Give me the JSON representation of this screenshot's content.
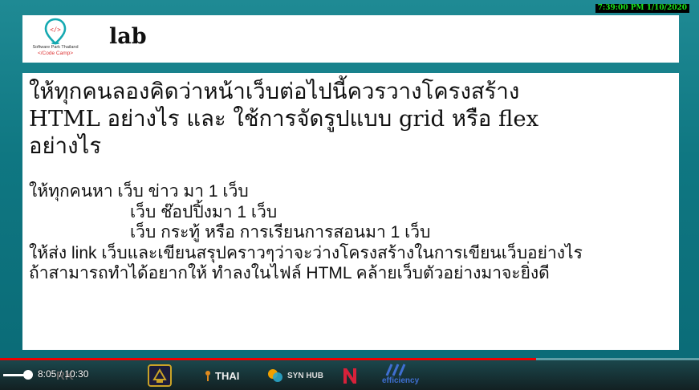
{
  "recording_timestamp": "7:39:00 PM 1/10/2020",
  "header": {
    "logo_line1": "Software Park Thailand",
    "logo_line2": "</Code Camp>",
    "title": "lab"
  },
  "content": {
    "heading_lines": [
      "ให้ทุกคนลองคิดว่าหน้าเว็บต่อไปนี้ควรวางโครงสร้าง",
      "HTML อย่างไร และ ใช้การจัดรูปแบบ grid หรือ flex",
      "อย่างไร"
    ],
    "task_lines": [
      "ให้ทุกคนหา เว็บ ข่าว มา 1 เว็บ",
      "เว็บ ช๊อปปิ้งมา 1 เว็บ",
      "เว็บ กระทู้ หรือ การเรียนการสอนมา 1 เว็บ",
      "ให้ส่ง link เว็บและเขียนสรุปคราวๆว่าจะว่างโครงสร้างในการเขียนเว็บอย่างไร",
      "ถ้าสามารถทำได้อยากให้ ทำลงในไฟล์ HTML คล้ายเว็บตัวอย่างมาจะยิ่งดี"
    ]
  },
  "player": {
    "current_time": "8:05",
    "duration": "10:30",
    "time_separator": " / ",
    "progress_fraction": 0.767,
    "volume_fraction": 1.0
  },
  "sponsors": {
    "thai": "THAI",
    "synhub": "SYN HUB",
    "efficiency": "efficiency",
    "dark_left": "RK"
  },
  "colors": {
    "background": "#0f7782",
    "timestamp_text": "#19e51b",
    "progress": "#e00000",
    "logo_accent": "#16a9b1"
  }
}
